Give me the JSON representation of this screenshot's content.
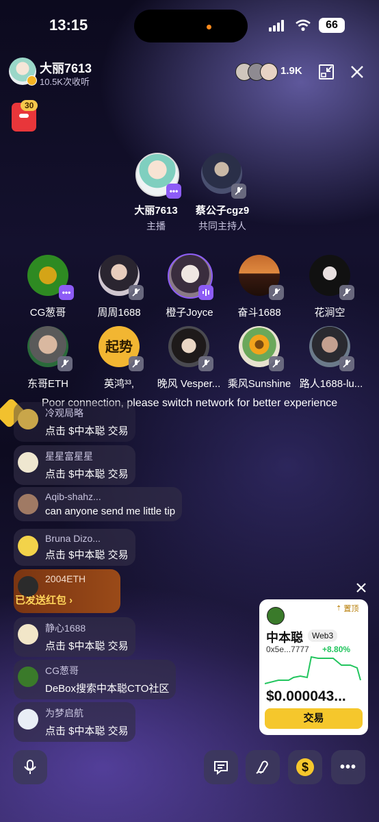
{
  "status_bar": {
    "time": "13:15",
    "battery": "66"
  },
  "host": {
    "name": "大丽7613",
    "listens": "10.5K次收听"
  },
  "viewers": {
    "count": "1.9K"
  },
  "red_packet": {
    "count": "30"
  },
  "stage": [
    {
      "name": "大丽7613",
      "role": "主播"
    },
    {
      "name": "蔡公子cgz9",
      "role": "共同主持人"
    }
  ],
  "speakers": [
    {
      "name": "CG葱哥"
    },
    {
      "name": "周周1688"
    },
    {
      "name": "橙子Joyce"
    },
    {
      "name": "奋斗1688"
    },
    {
      "name": "花涧空"
    },
    {
      "name": "东哥ETH"
    },
    {
      "name": "英鸿³³,"
    },
    {
      "name": "晚风 Vesper..."
    },
    {
      "name": "乘风Sunshine"
    },
    {
      "name": "路人1688-lu..."
    }
  ],
  "speaker_badge_text": "起势",
  "toast": "Poor connection, please switch network for better experience",
  "chat": [
    {
      "name": "冷观局略",
      "msg": "点击 $中本聪 交易"
    },
    {
      "name": "星星富星星",
      "msg": "点击 $中本聪 交易"
    },
    {
      "name": "Aqib-shahz...",
      "msg": "can anyone send me little tip"
    },
    {
      "name": "Bruna Dizo...",
      "msg": "点击 $中本聪 交易"
    },
    {
      "name": "2004ETH",
      "msg": "已发送红包 ›"
    },
    {
      "name": "静心1688",
      "msg": "点击 $中本聪 交易"
    },
    {
      "name": "CG葱哥",
      "msg": "DeBox搜索中本聪CTO社区"
    },
    {
      "name": "为梦启航",
      "msg": "点击 $中本聪 交易"
    }
  ],
  "token_card": {
    "pin_label": "置顶",
    "name": "中本聪",
    "tag": "Web3",
    "address": "0x5e...7777",
    "change": "+8.80%",
    "price": "$0.000043...",
    "trade_label": "交易"
  },
  "colors": {
    "accent": "#8d5cf6",
    "positive": "#22c55e",
    "trade_btn": "#f5c72c",
    "red_packet_chat": "#8a3c12"
  }
}
